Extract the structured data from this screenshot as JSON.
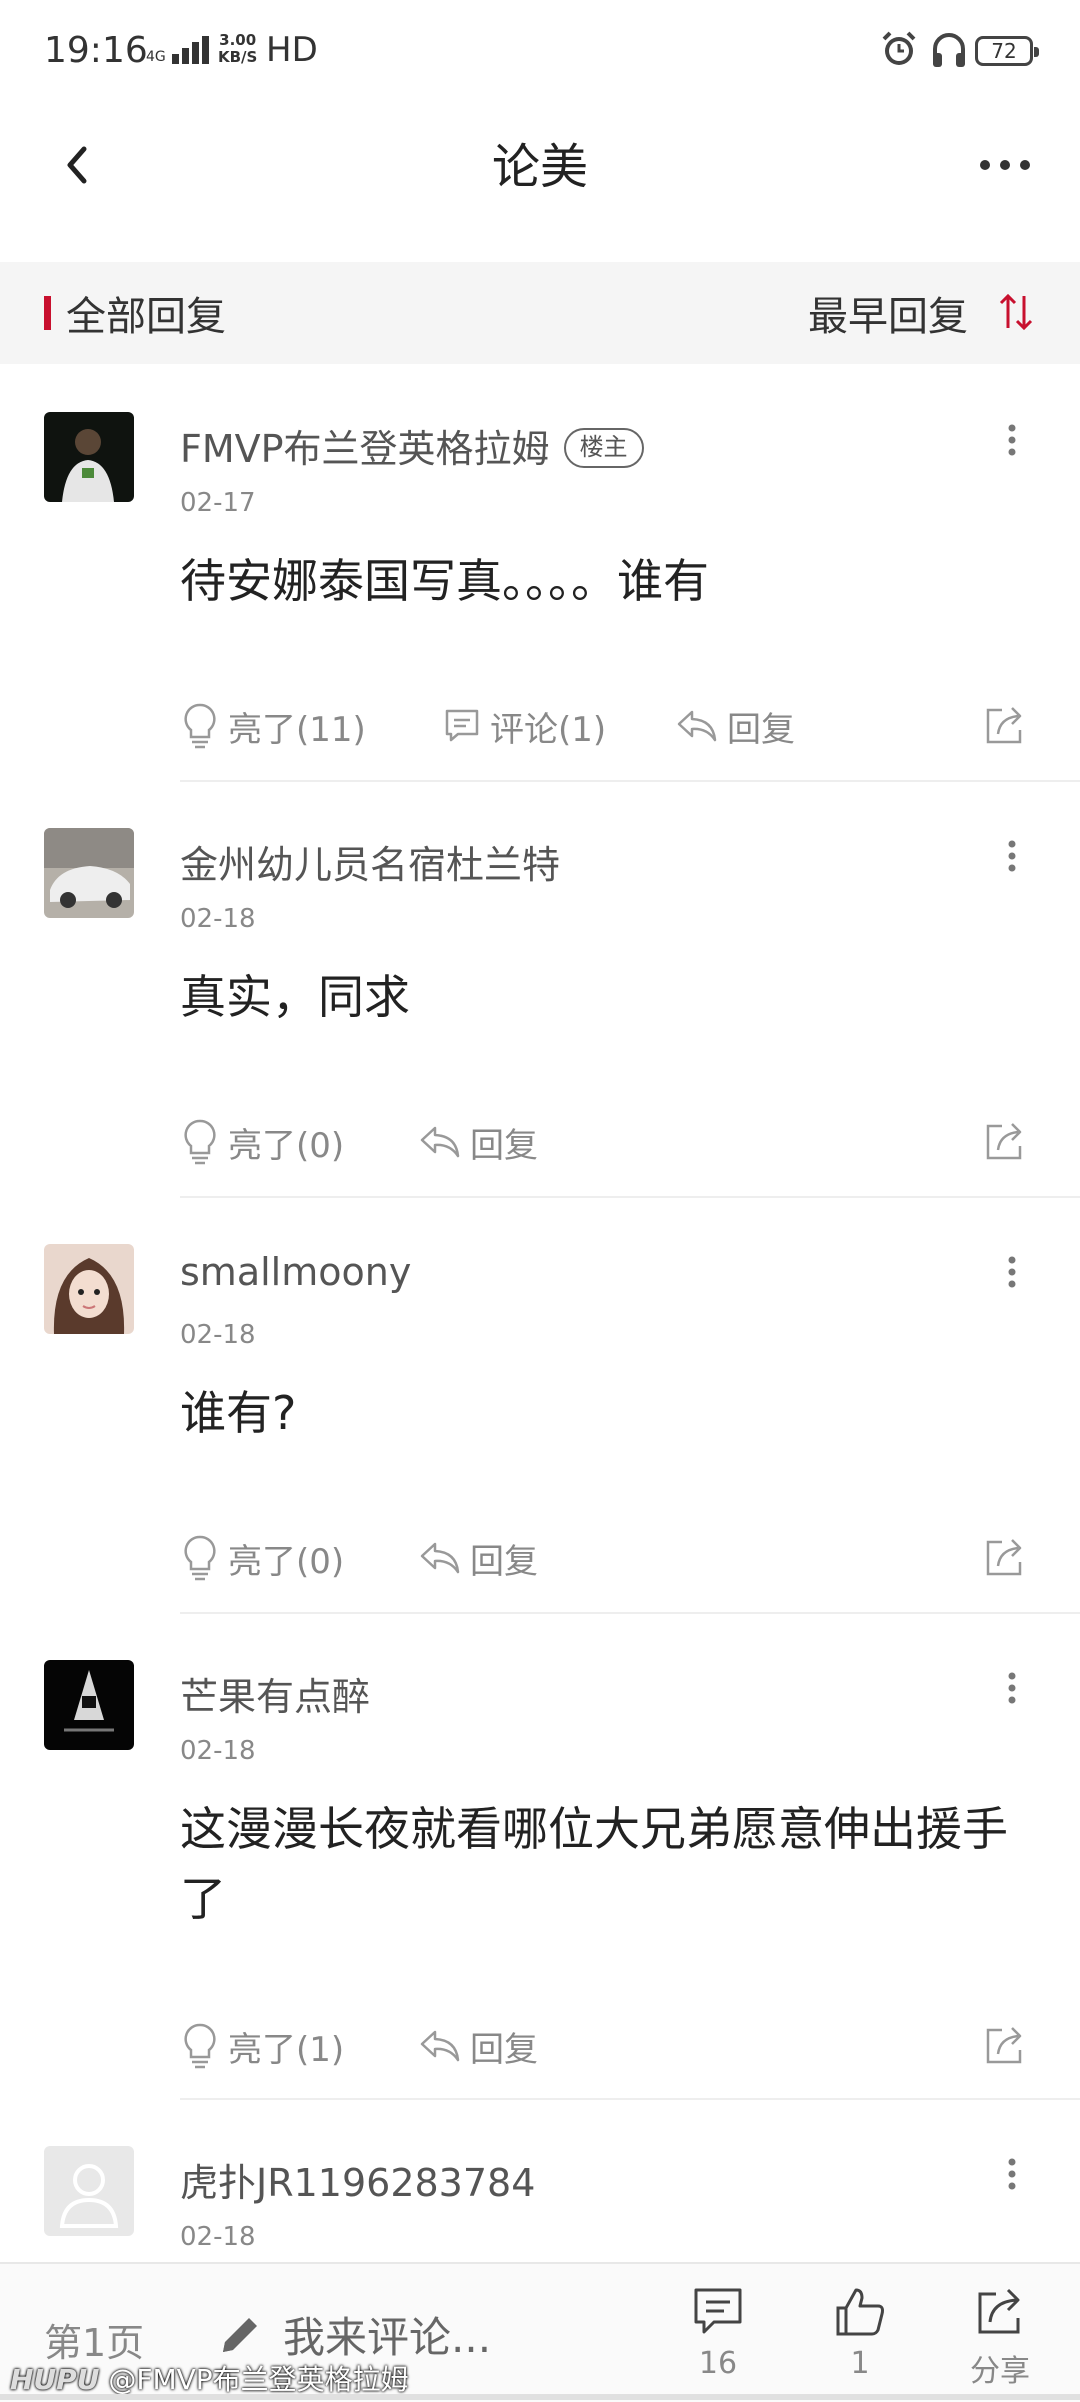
{
  "status_bar": {
    "time": "19:16",
    "network": "4G",
    "speed_value": "3.00",
    "speed_unit": "KB/S",
    "hd": "HD",
    "battery": "72"
  },
  "header": {
    "title": "论美"
  },
  "reply_header": {
    "all_label": "全部回复",
    "sort_label": "最早回复",
    "accent": "#c8102e"
  },
  "posts": [
    {
      "username": "FMVP布兰登英格拉姆",
      "badge": "楼主",
      "date": "02-17",
      "content": "待安娜泰国写真。。。。谁有",
      "like_label": "亮了(11)",
      "comment_label": "评论(1)",
      "reply_label": "回复"
    },
    {
      "username": "金州幼儿员名宿杜兰特",
      "date": "02-18",
      "content": "真实，同求",
      "like_label": "亮了(0)",
      "reply_label": "回复"
    },
    {
      "username": "smallmoony",
      "date": "02-18",
      "content": "谁有?",
      "like_label": "亮了(0)",
      "reply_label": "回复"
    },
    {
      "username": "芒果有点醉",
      "date": "02-18",
      "content": "这漫漫长夜就看哪位大兄弟愿意伸出援手了",
      "like_label": "亮了(1)",
      "reply_label": "回复"
    },
    {
      "username": "虎扑JR1196283784",
      "date": "02-18"
    }
  ],
  "bottom_bar": {
    "page_label": "第1页",
    "comment_placeholder": "我来评论...",
    "comments_count": "16",
    "likes_count": "1",
    "share_label": "分享"
  },
  "watermark": {
    "brand": "HUPU",
    "author": "@FMVP布兰登英格拉姆"
  }
}
